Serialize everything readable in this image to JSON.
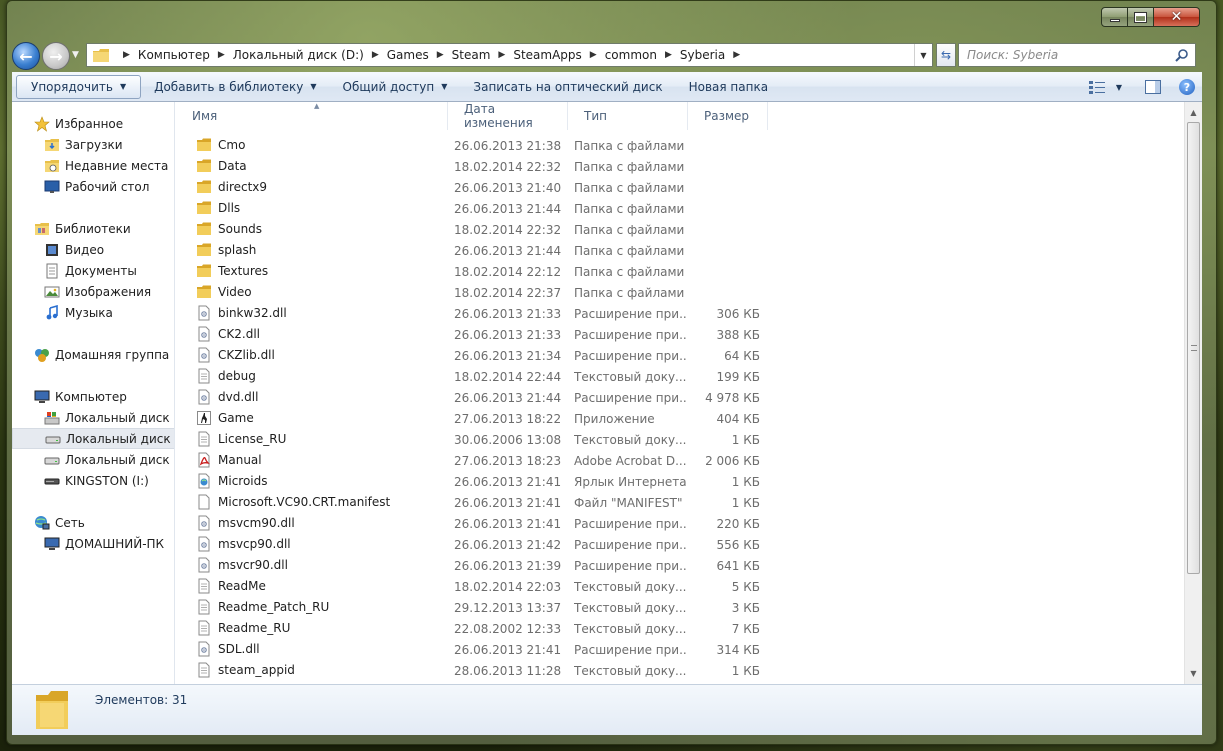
{
  "window": {
    "caption_min": "–",
    "caption_max": "□",
    "caption_close": "✕"
  },
  "address": {
    "crumbs": [
      "Компьютер",
      "Локальный диск (D:)",
      "Games",
      "Steam",
      "SteamApps",
      "common",
      "Syberia"
    ],
    "search_placeholder": "Поиск: Syberia"
  },
  "toolbar": {
    "organize": "Упорядочить",
    "add_library": "Добавить в библиотеку",
    "share": "Общий доступ",
    "burn": "Записать на оптический диск",
    "new_folder": "Новая папка",
    "help": "?"
  },
  "sidebar": {
    "favorites": {
      "label": "Избранное",
      "items": [
        "Загрузки",
        "Недавние места",
        "Рабочий стол"
      ]
    },
    "libraries": {
      "label": "Библиотеки",
      "items": [
        "Видео",
        "Документы",
        "Изображения",
        "Музыка"
      ]
    },
    "homegroup": {
      "label": "Домашняя группа"
    },
    "computer": {
      "label": "Компьютер",
      "items": [
        "Локальный диск (C:)",
        "Локальный диск (D:)",
        "Локальный диск (E:)",
        "KINGSTON (I:)"
      ]
    },
    "network": {
      "label": "Сеть",
      "items": [
        "ДОМАШНИЙ-ПК"
      ]
    }
  },
  "columns": {
    "name": "Имя",
    "date": "Дата изменения",
    "type": "Тип",
    "size": "Размер"
  },
  "files": [
    {
      "name": "Cmo",
      "date": "26.06.2013 21:38",
      "type": "Папка с файлами",
      "size": "",
      "icon": "folder"
    },
    {
      "name": "Data",
      "date": "18.02.2014 22:32",
      "type": "Папка с файлами",
      "size": "",
      "icon": "folder"
    },
    {
      "name": "directx9",
      "date": "26.06.2013 21:40",
      "type": "Папка с файлами",
      "size": "",
      "icon": "folder"
    },
    {
      "name": "Dlls",
      "date": "26.06.2013 21:44",
      "type": "Папка с файлами",
      "size": "",
      "icon": "folder"
    },
    {
      "name": "Sounds",
      "date": "18.02.2014 22:32",
      "type": "Папка с файлами",
      "size": "",
      "icon": "folder"
    },
    {
      "name": "splash",
      "date": "26.06.2013 21:44",
      "type": "Папка с файлами",
      "size": "",
      "icon": "folder"
    },
    {
      "name": "Textures",
      "date": "18.02.2014 22:12",
      "type": "Папка с файлами",
      "size": "",
      "icon": "folder"
    },
    {
      "name": "Video",
      "date": "18.02.2014 22:37",
      "type": "Папка с файлами",
      "size": "",
      "icon": "folder"
    },
    {
      "name": "binkw32.dll",
      "date": "26.06.2013 21:33",
      "type": "Расширение при...",
      "size": "306 КБ",
      "icon": "dll"
    },
    {
      "name": "CK2.dll",
      "date": "26.06.2013 21:33",
      "type": "Расширение при...",
      "size": "388 КБ",
      "icon": "dll"
    },
    {
      "name": "CKZlib.dll",
      "date": "26.06.2013 21:34",
      "type": "Расширение при...",
      "size": "64 КБ",
      "icon": "dll"
    },
    {
      "name": "debug",
      "date": "18.02.2014 22:44",
      "type": "Текстовый доку...",
      "size": "199 КБ",
      "icon": "text"
    },
    {
      "name": "dvd.dll",
      "date": "26.06.2013 21:44",
      "type": "Расширение при...",
      "size": "4 978 КБ",
      "icon": "dll"
    },
    {
      "name": "Game",
      "date": "27.06.2013 18:22",
      "type": "Приложение",
      "size": "404 КБ",
      "icon": "app"
    },
    {
      "name": "License_RU",
      "date": "30.06.2006 13:08",
      "type": "Текстовый доку...",
      "size": "1 КБ",
      "icon": "text"
    },
    {
      "name": "Manual",
      "date": "27.06.2013 18:23",
      "type": "Adobe Acrobat D...",
      "size": "2 006 КБ",
      "icon": "pdf"
    },
    {
      "name": "Microids",
      "date": "26.06.2013 21:41",
      "type": "Ярлык Интернета",
      "size": "1 КБ",
      "icon": "url"
    },
    {
      "name": "Microsoft.VC90.CRT.manifest",
      "date": "26.06.2013 21:41",
      "type": "Файл \"MANIFEST\"",
      "size": "1 КБ",
      "icon": "blank"
    },
    {
      "name": "msvcm90.dll",
      "date": "26.06.2013 21:41",
      "type": "Расширение при...",
      "size": "220 КБ",
      "icon": "dll"
    },
    {
      "name": "msvcp90.dll",
      "date": "26.06.2013 21:42",
      "type": "Расширение при...",
      "size": "556 КБ",
      "icon": "dll"
    },
    {
      "name": "msvcr90.dll",
      "date": "26.06.2013 21:39",
      "type": "Расширение при...",
      "size": "641 КБ",
      "icon": "dll"
    },
    {
      "name": "ReadMe",
      "date": "18.02.2014 22:03",
      "type": "Текстовый доку...",
      "size": "5 КБ",
      "icon": "text"
    },
    {
      "name": "Readme_Patch_RU",
      "date": "29.12.2013 13:37",
      "type": "Текстовый доку...",
      "size": "3 КБ",
      "icon": "text"
    },
    {
      "name": "Readme_RU",
      "date": "22.08.2002 12:33",
      "type": "Текстовый доку...",
      "size": "7 КБ",
      "icon": "text"
    },
    {
      "name": "SDL.dll",
      "date": "26.06.2013 21:41",
      "type": "Расширение при...",
      "size": "314 КБ",
      "icon": "dll"
    },
    {
      "name": "steam_appid",
      "date": "28.06.2013 11:28",
      "type": "Текстовый доку...",
      "size": "1 КБ",
      "icon": "text"
    }
  ],
  "details": {
    "count_text": "Элементов: 31"
  },
  "colors": {
    "folder": "#f2cd5a",
    "folder_dark": "#d9a628",
    "accent": "#1e395b"
  }
}
